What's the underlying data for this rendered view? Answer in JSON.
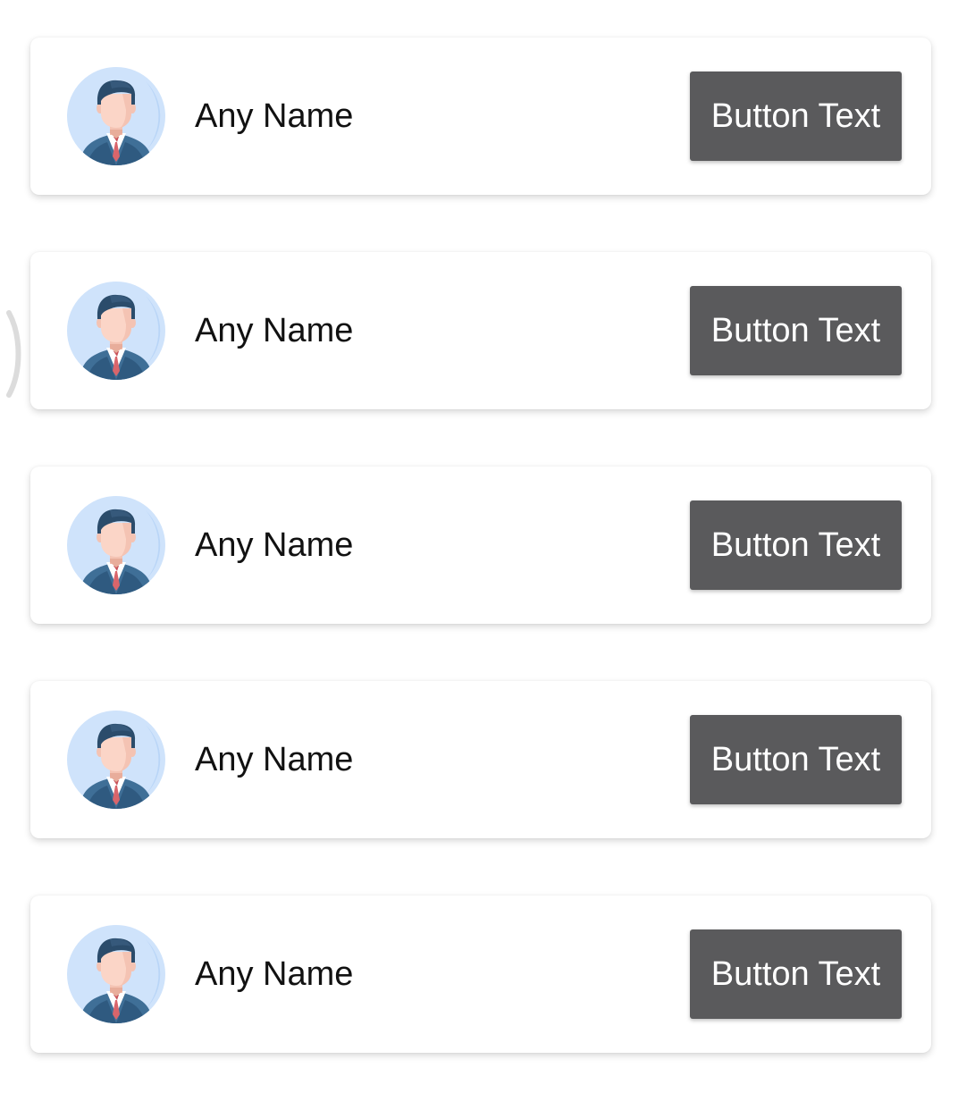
{
  "items": [
    {
      "name": "Any Name",
      "button_label": "Button Text",
      "avatar_icon": "businessman-avatar-icon"
    },
    {
      "name": "Any Name",
      "button_label": "Button Text",
      "avatar_icon": "businessman-avatar-icon"
    },
    {
      "name": "Any Name",
      "button_label": "Button Text",
      "avatar_icon": "businessman-avatar-icon"
    },
    {
      "name": "Any Name",
      "button_label": "Button Text",
      "avatar_icon": "businessman-avatar-icon"
    },
    {
      "name": "Any Name",
      "button_label": "Button Text",
      "avatar_icon": "businessman-avatar-icon"
    }
  ],
  "colors": {
    "button_background": "#5a5a5c",
    "button_text": "#ffffff",
    "card_background": "#ffffff",
    "avatar_background": "#cfe3fb",
    "suit": "#3f6f97",
    "tie": "#d9656b"
  }
}
